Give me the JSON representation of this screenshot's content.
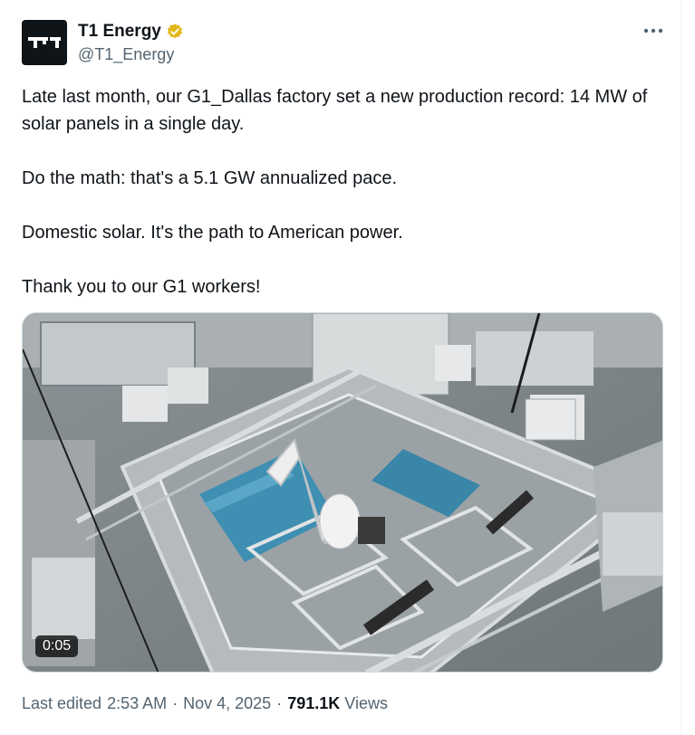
{
  "author": {
    "name": "T1 Energy",
    "handle": "@T1_Energy",
    "logo_text": "T1",
    "verified": true
  },
  "more_icon": "more-horizontal-icon",
  "tweet": {
    "paragraphs": [
      "Late last month, our G1_Dallas factory set a new production record: 14 MW of solar panels in a single day.",
      "Do the math: that's a 5.1 GW annualized pace.",
      "Domestic solar. It's the path to American power.",
      "Thank you to our G1 workers!"
    ]
  },
  "media": {
    "type": "video",
    "duration": "0:05"
  },
  "meta": {
    "edited_label": "Last edited",
    "time": "2:53 AM",
    "separator": "·",
    "date": "Nov 4, 2025",
    "views_count": "791.1K",
    "views_label": "Views"
  },
  "colors": {
    "text": "#0f1419",
    "secondary": "#536471",
    "verified_badge": "#e2b719",
    "border": "#cfd9de"
  }
}
